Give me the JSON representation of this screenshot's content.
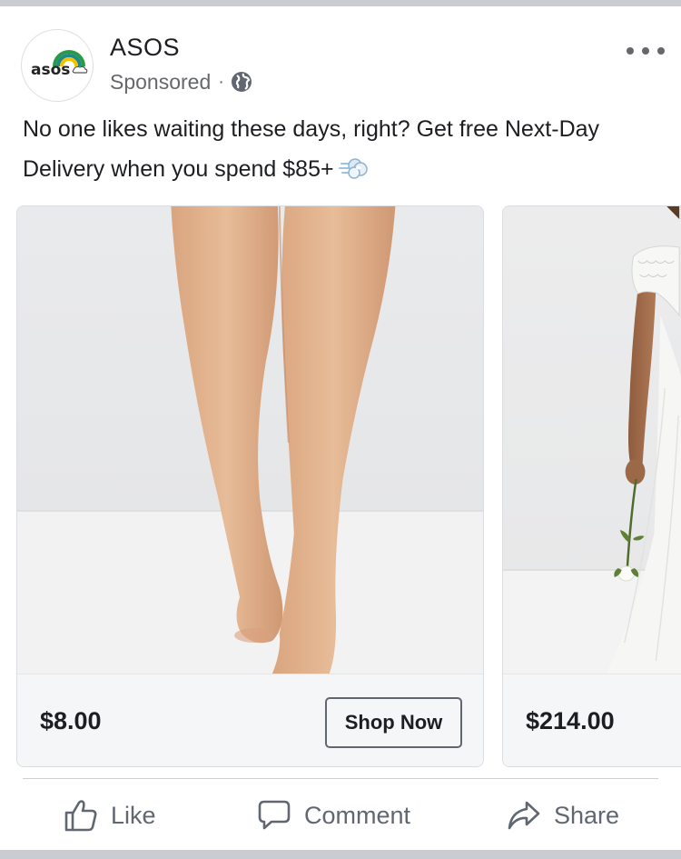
{
  "post": {
    "page_name": "ASOS",
    "sponsored_label": "Sponsored",
    "separator": "·",
    "avatar_logo_text": "asos",
    "text": "No one likes waiting these days, right? Get free Next-Day Delivery when you spend $85+",
    "emoji": "dashing-away-emoji"
  },
  "carousel": {
    "cards": [
      {
        "price": "$8.00",
        "button_label": "Shop Now",
        "image": "legs-barefoot-photo"
      },
      {
        "price": "$214.00",
        "image": "bride-white-dress-photo"
      }
    ]
  },
  "actions": {
    "like_label": "Like",
    "comment_label": "Comment",
    "share_label": "Share"
  },
  "colors": {
    "text_primary": "#1c1e21",
    "text_secondary": "#65676b",
    "card_bg": "#f5f6f7",
    "separator_bar": "#c9ccd1"
  }
}
